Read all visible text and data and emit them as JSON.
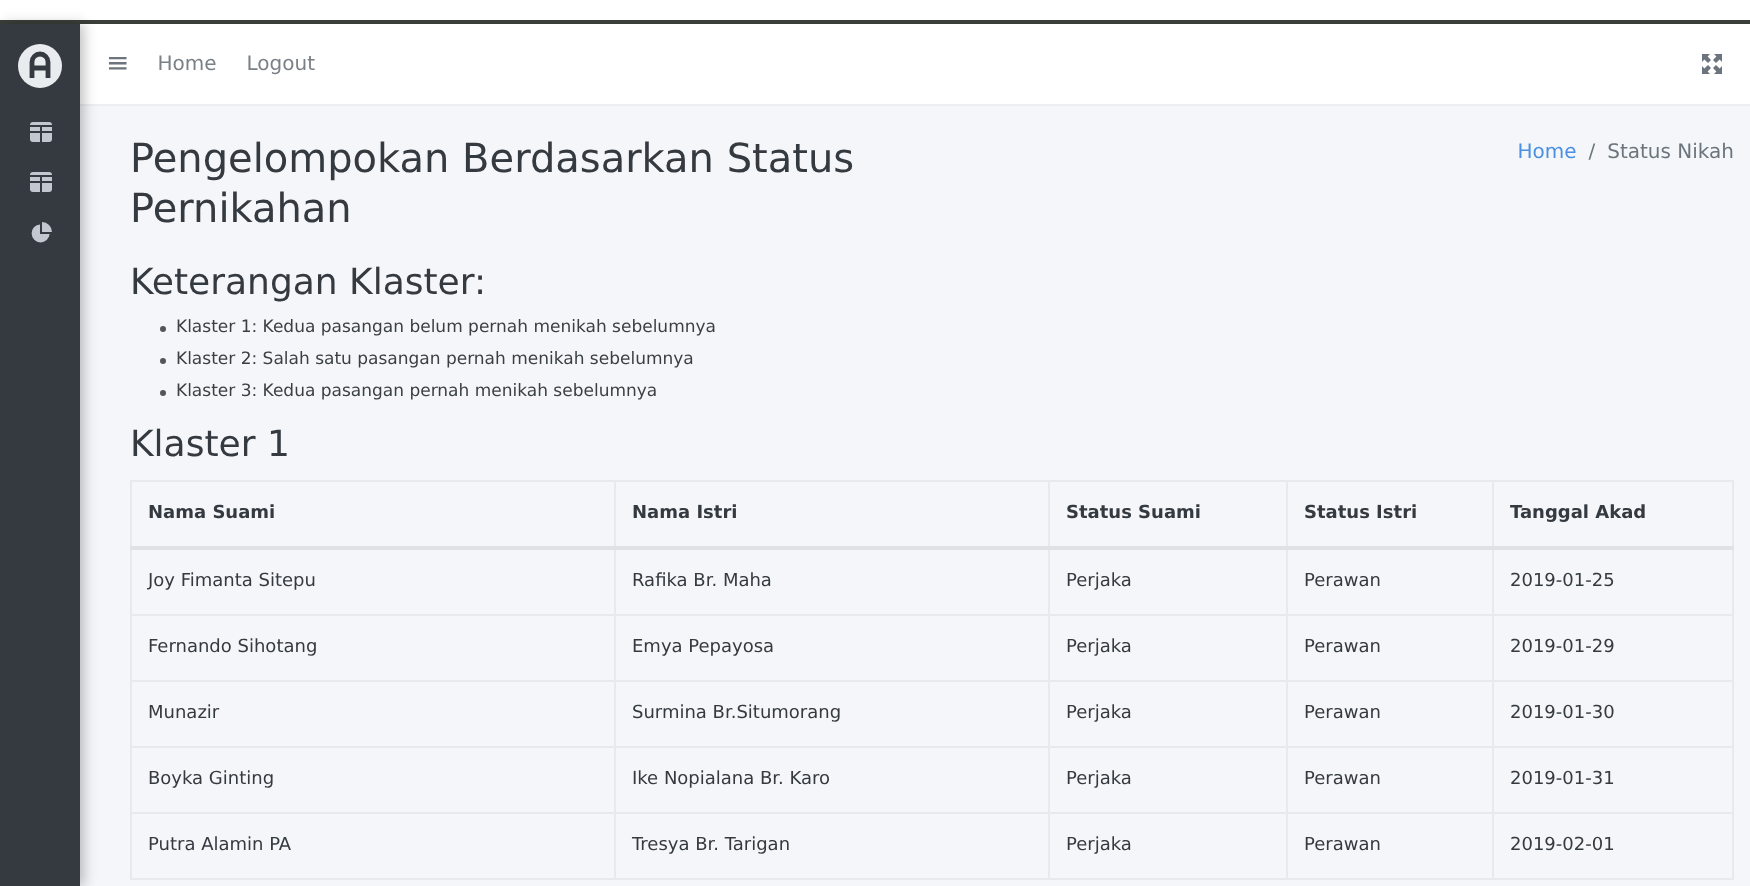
{
  "navbar": {
    "menu_icon": "≡",
    "links": [
      "Home",
      "Logout"
    ]
  },
  "page_title": "Pengelompokan Berdasarkan Status Pernikahan",
  "breadcrumb_separator": "/",
  "breadcrumb": [
    {
      "label": "Home",
      "link": true
    },
    {
      "label": "Status Nikah",
      "link": false
    }
  ],
  "legend": {
    "heading": "Keterangan Klaster:",
    "items": [
      "Klaster 1: Kedua pasangan belum pernah menikah sebelumnya",
      "Klaster 2: Salah satu pasangan pernah menikah sebelumnya",
      "Klaster 3: Kedua pasangan pernah menikah sebelumnya"
    ]
  },
  "section_title": "Klaster 1",
  "table": {
    "columns": [
      "Nama Suami",
      "Nama Istri",
      "Status Suami",
      "Status Istri",
      "Tanggal Akad"
    ],
    "rows": [
      [
        "Joy Fimanta Sitepu",
        "Rafika Br. Maha",
        "Perjaka",
        "Perawan",
        "2019-01-25"
      ],
      [
        "Fernando Sihotang",
        "Emya Pepayosa",
        "Perjaka",
        "Perawan",
        "2019-01-29"
      ],
      [
        "Munazir",
        "Surmina Br.Situmorang",
        "Perjaka",
        "Perawan",
        "2019-01-30"
      ],
      [
        "Boyka Ginting",
        "Ike Nopialana Br. Karo",
        "Perjaka",
        "Perawan",
        "2019-01-31"
      ],
      [
        "Putra Alamin PA",
        "Tresya Br. Tarigan",
        "Perjaka",
        "Perawan",
        "2019-02-01"
      ]
    ]
  }
}
